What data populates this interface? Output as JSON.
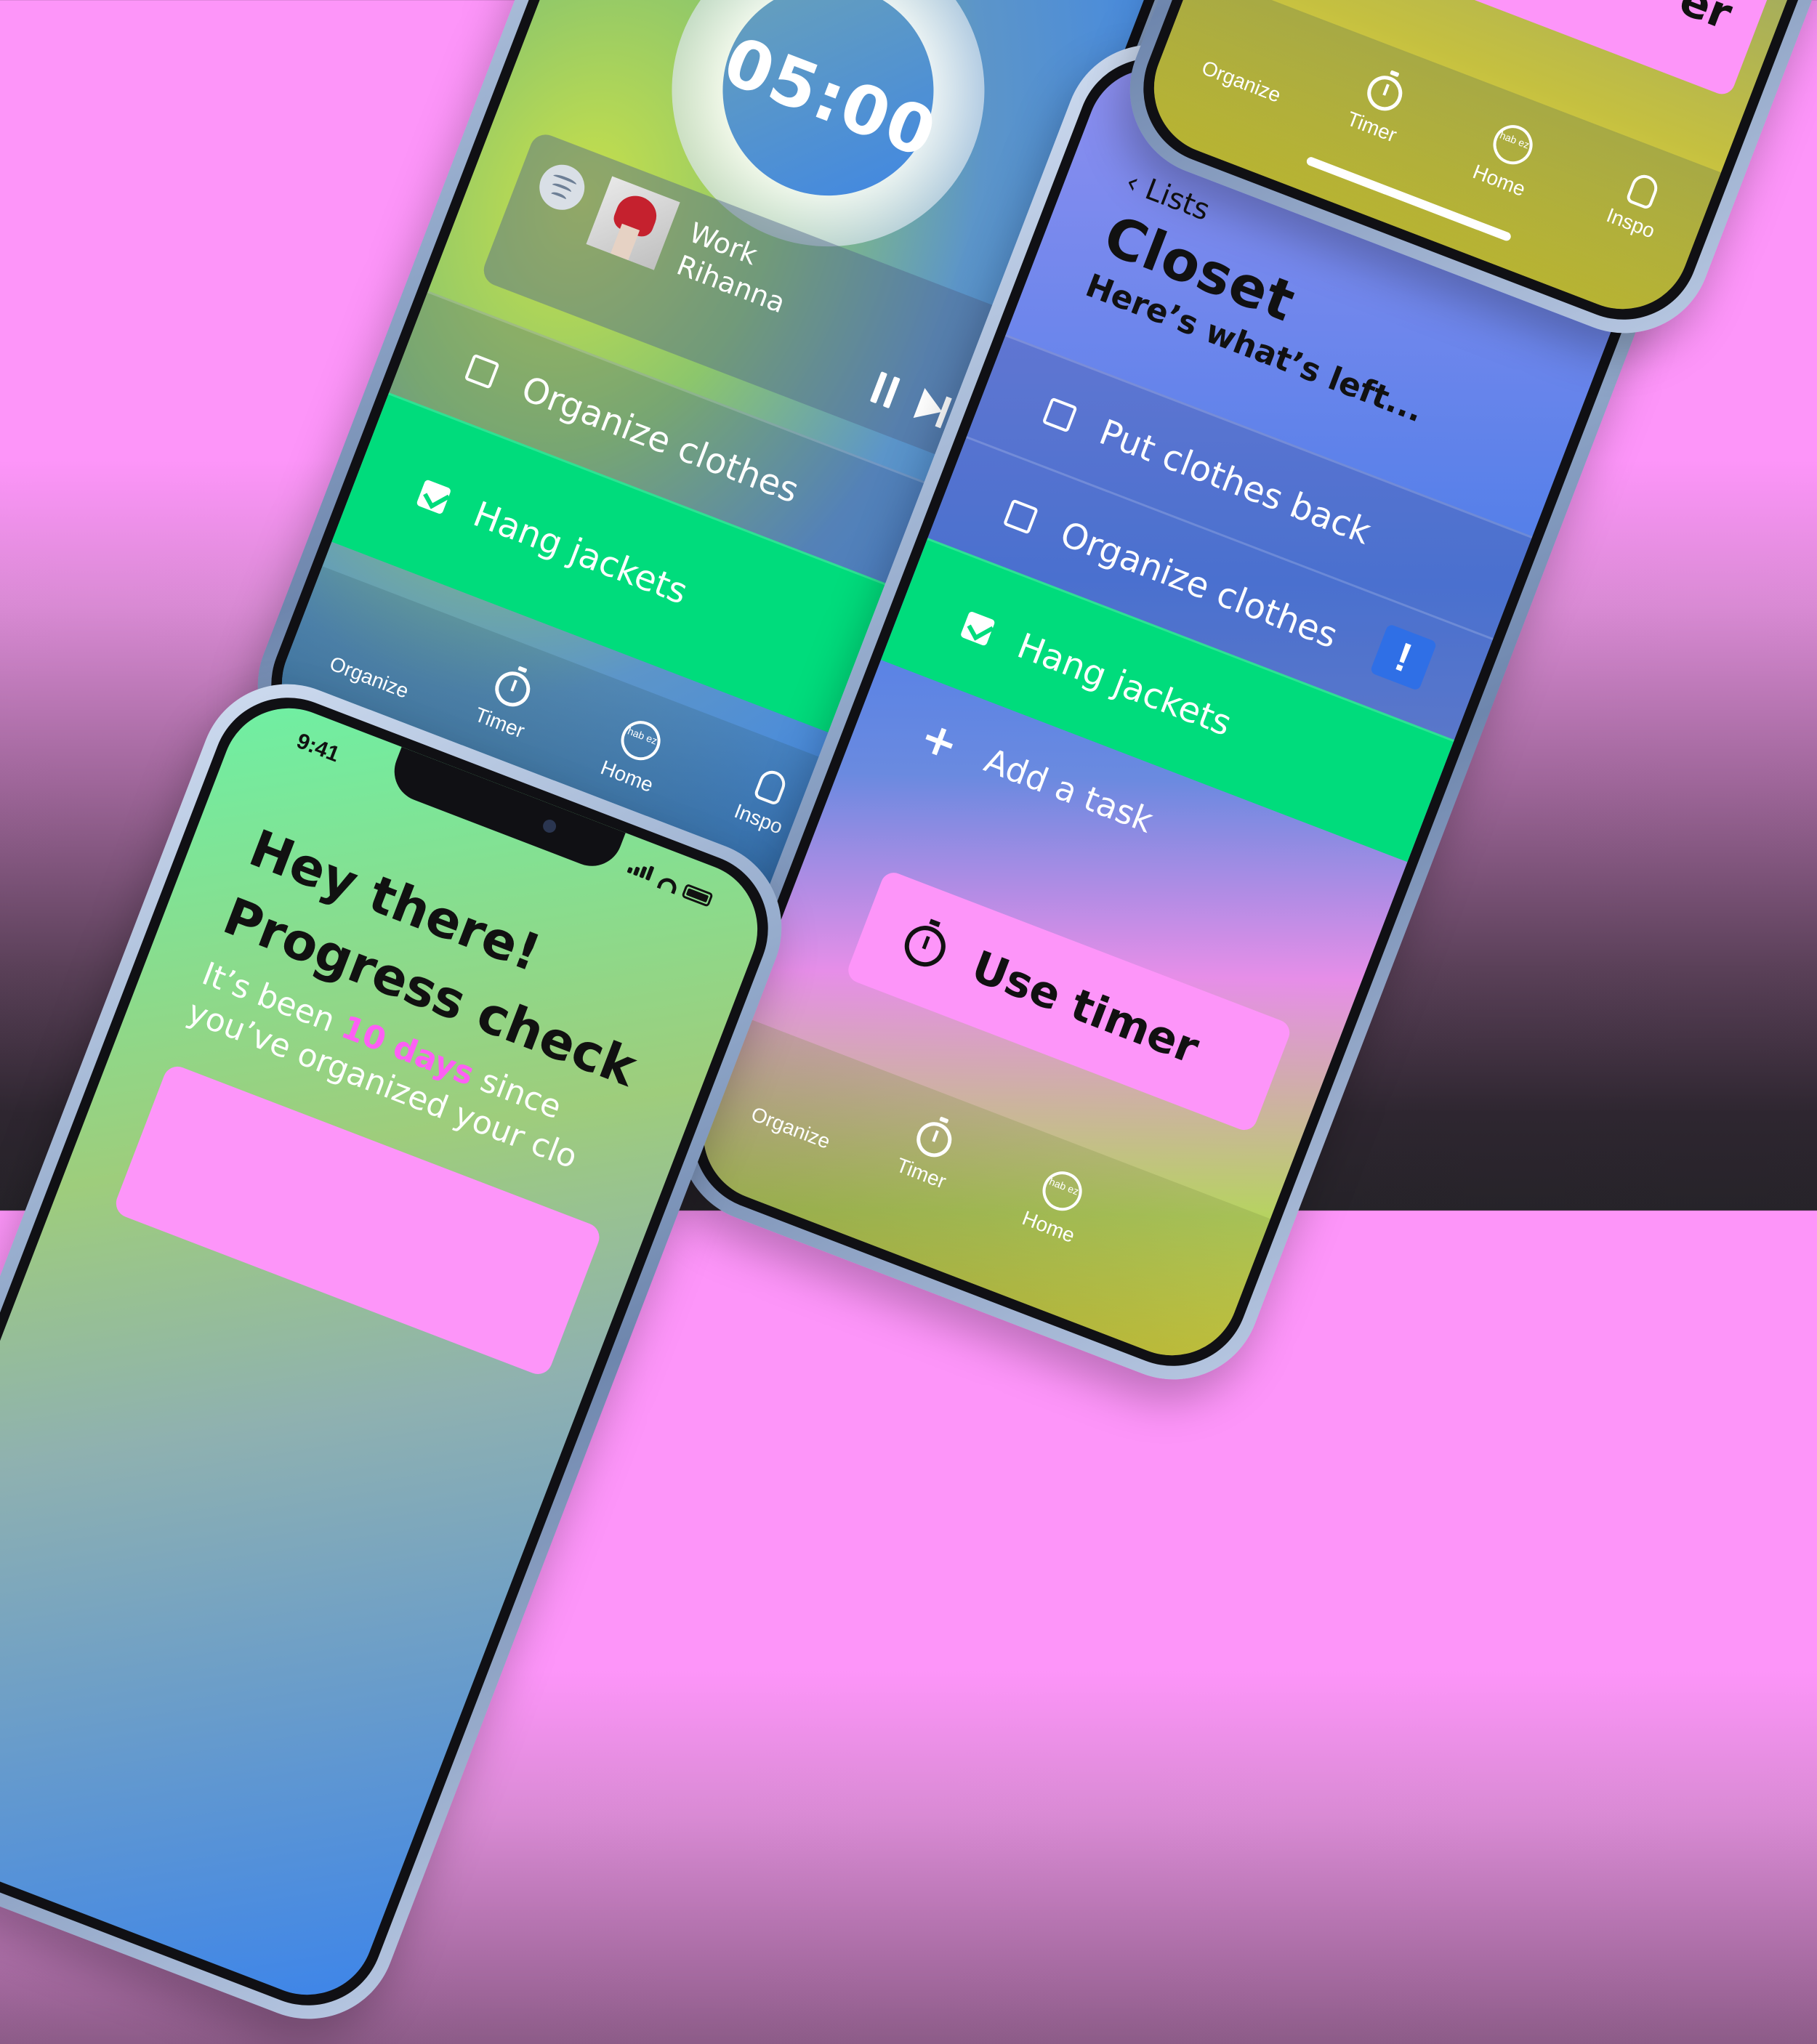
{
  "status": {
    "time": "9:41"
  },
  "tabs": {
    "organize": "Organize",
    "timer": "Timer",
    "home": "Home",
    "inspo": "Inspo",
    "home_logo": "hab ez"
  },
  "timer_screen": {
    "countdown": "05:00",
    "player": {
      "song": "Work",
      "artist": "Rihanna"
    },
    "tasks": [
      {
        "label": "Organize clothes",
        "checked": false
      },
      {
        "label": "Hang jackets",
        "checked": true
      }
    ]
  },
  "closet_screen": {
    "back_label": "Lists",
    "title": "Closet",
    "subtitle": "Here’s what’s left...",
    "alert_symbol": "!",
    "tasks": [
      {
        "label": "Put clothes back",
        "checked": false
      },
      {
        "label": "Organize clothes",
        "checked": false
      },
      {
        "label": "Hang jackets",
        "checked": true
      }
    ],
    "add_task": "Add a task",
    "add_symbol": "+",
    "cta": "Use timer"
  },
  "home_screen": {
    "greeting": "Hey there!",
    "heading": "Progress check",
    "body_before": "It’s been ",
    "body_highlight": "10 days",
    "body_after": " since you’ve organized your clo"
  },
  "partial_screen": {
    "cta_partial": "er"
  },
  "colors": {
    "accent_pink": "#fd95f9",
    "accent_green": "#00dc7c",
    "accent_blue": "#3c84ea",
    "accent_yellow": "#f5e83a"
  },
  "icons": {
    "organize": "grid-icon",
    "timer": "stopwatch-icon",
    "home": "hab-ez-logo",
    "inspo": "lightbulb-icon",
    "music": "spotify-icon",
    "pause": "pause-icon",
    "skip": "skip-next-icon",
    "back": "chevron-left-icon",
    "alert": "exclamation-icon"
  }
}
